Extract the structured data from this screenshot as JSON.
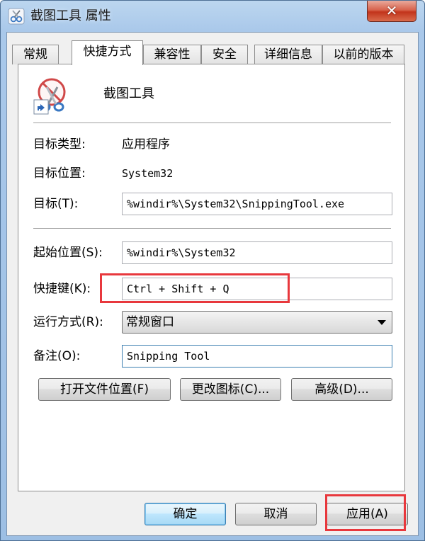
{
  "window": {
    "title": "截图工具 属性",
    "close_glyph": "✕"
  },
  "tabs": [
    {
      "label": "常规",
      "active": false
    },
    {
      "label": "快捷方式",
      "active": true
    },
    {
      "label": "兼容性",
      "active": false
    },
    {
      "label": "安全",
      "active": false
    },
    {
      "label": "详细信息",
      "active": false
    },
    {
      "label": "以前的版本",
      "active": false
    }
  ],
  "shortcut": {
    "app_name": "截图工具",
    "app_icon": "scissors-shortcut-icon",
    "target_type_label": "目标类型:",
    "target_type_value": "应用程序",
    "target_location_label": "目标位置:",
    "target_location_value": "System32",
    "target_label": "目标(T):",
    "target_value": "%windir%\\System32\\SnippingTool.exe",
    "start_in_label": "起始位置(S):",
    "start_in_value": "%windir%\\System32",
    "hotkey_label": "快捷键(K):",
    "hotkey_value": "Ctrl + Shift + Q",
    "run_label": "运行方式(R):",
    "run_value": "常规窗口",
    "comment_label": "备注(O):",
    "comment_value": "Snipping Tool",
    "open_location_button": "打开文件位置(F)",
    "change_icon_button": "更改图标(C)...",
    "advanced_button": "高级(D)..."
  },
  "footer": {
    "ok": "确定",
    "cancel": "取消",
    "apply": "应用(A)"
  },
  "colors": {
    "highlight": "#e8383d",
    "window_frame": "#a9c8ea"
  }
}
